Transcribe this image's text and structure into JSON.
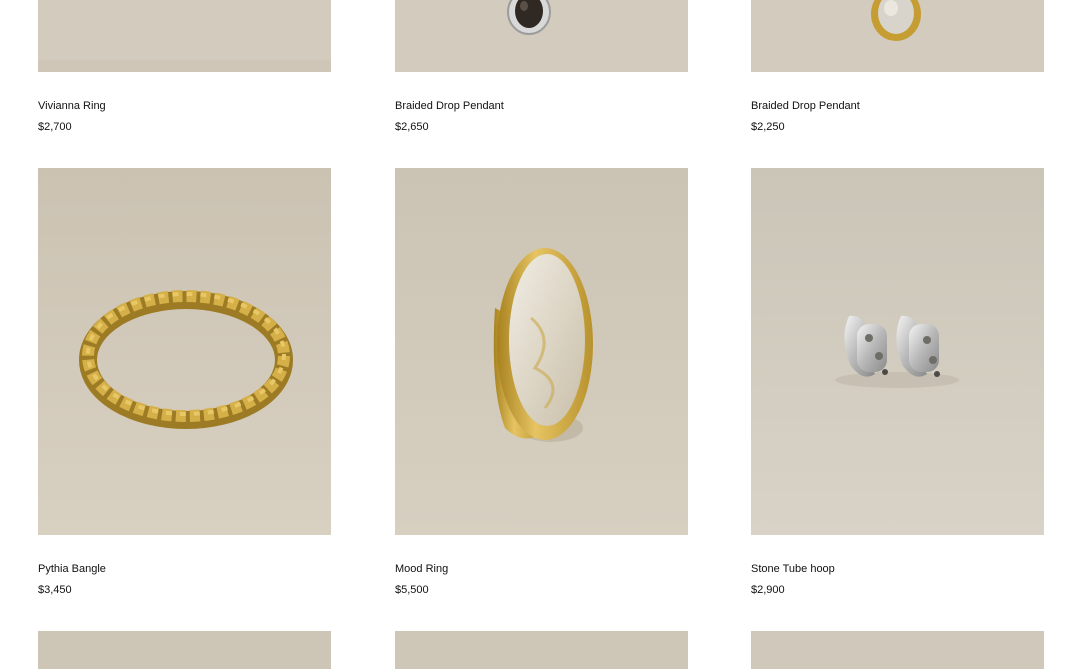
{
  "products_row1": [
    {
      "name": "Vivianna Ring",
      "price": "$2,700"
    },
    {
      "name": "Braided Drop Pendant",
      "price": "$2,650"
    },
    {
      "name": "Braided Drop Pendant",
      "price": "$2,250"
    }
  ],
  "products_row2": [
    {
      "name": "Pythia Bangle",
      "price": "$3,450"
    },
    {
      "name": "Mood Ring",
      "price": "$5,500"
    },
    {
      "name": "Stone Tube hoop",
      "price": "$2,900"
    }
  ],
  "colors": {
    "background": "#d3cbbd",
    "gold": "#c9a640",
    "silver": "#c8c8c8",
    "text": "#111111"
  }
}
